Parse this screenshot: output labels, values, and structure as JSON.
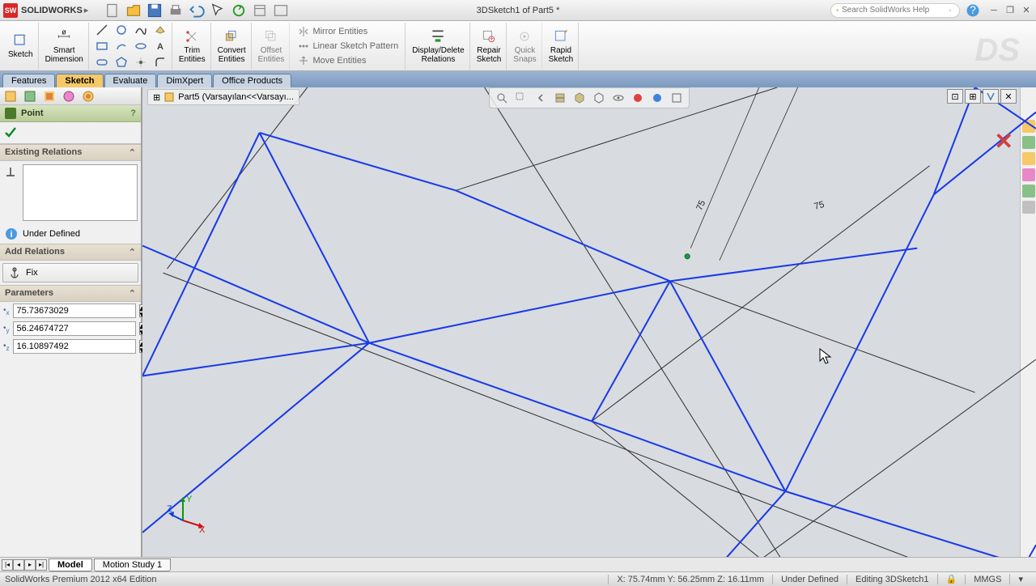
{
  "app": {
    "name": "SOLIDWORKS",
    "doc_title": "3DSketch1 of Part5 *"
  },
  "search": {
    "placeholder": "Search SolidWorks Help"
  },
  "ribbon": {
    "sketch": "Sketch",
    "smart_dim": "Smart\nDimension",
    "trim": "Trim\nEntities",
    "convert": "Convert\nEntities",
    "offset": "Offset\nEntities",
    "display_delete": "Display/Delete\nRelations",
    "repair": "Repair\nSketch",
    "quick": "Quick\nSnaps",
    "rapid": "Rapid\nSketch",
    "mirror": "Mirror Entities",
    "linear": "Linear Sketch Pattern",
    "move": "Move Entities"
  },
  "tabs": [
    "Features",
    "Sketch",
    "Evaluate",
    "DimXpert",
    "Office Products"
  ],
  "active_tab": 1,
  "breadcrumb": "Part5  (Varsayılan<<Varsayı...",
  "panel": {
    "title": "Point",
    "sections": {
      "existing": "Existing Relations",
      "add": "Add Relations",
      "params": "Parameters"
    },
    "status": "Under Defined",
    "fix": "Fix",
    "params": {
      "x": "75.73673029",
      "y": "56.24674727",
      "z": "16.10897492"
    }
  },
  "dims": {
    "d1": "75",
    "d2": "75"
  },
  "bottom_tabs": [
    "Model",
    "Motion Study 1"
  ],
  "status": {
    "edition": "SolidWorks Premium 2012 x64 Edition",
    "coords": "X: 75.74mm Y: 56.25mm Z: 16.11mm",
    "define": "Under Defined",
    "editing": "Editing 3DSketch1",
    "units": "MMGS"
  }
}
